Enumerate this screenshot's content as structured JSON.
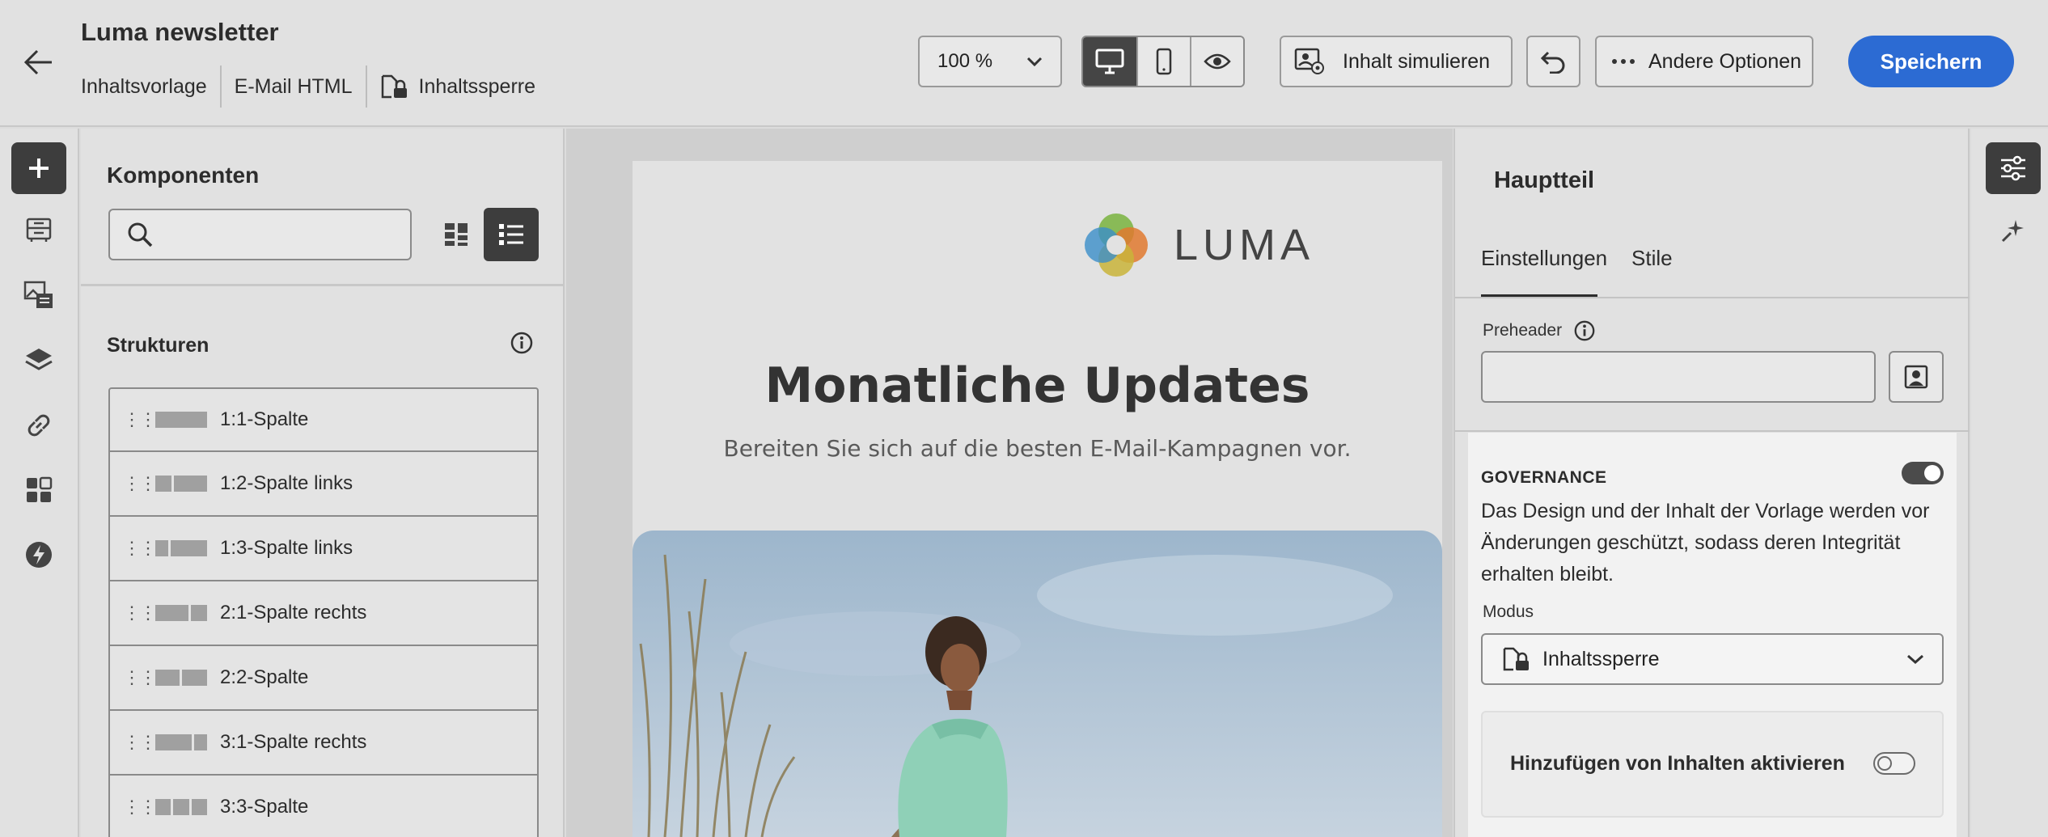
{
  "header": {
    "title": "Luma newsletter",
    "meta": [
      "Inhaltsvorlage",
      "E-Mail HTML"
    ],
    "lock_label": "Inhaltssperre",
    "zoom": "100 %",
    "simulate_label": "Inhalt simulieren",
    "options_label": "Andere Optionen",
    "save_label": "Speichern",
    "accent_color": "#2c6bd3"
  },
  "components": {
    "title": "Komponenten",
    "search_placeholder": "",
    "structures_title": "Strukturen",
    "structures": [
      {
        "label": "1:1-Spalte"
      },
      {
        "label": "1:2-Spalte links"
      },
      {
        "label": "1:3-Spalte links"
      },
      {
        "label": "2:1-Spalte rechts"
      },
      {
        "label": "2:2-Spalte"
      },
      {
        "label": "3:1-Spalte rechts"
      },
      {
        "label": "3:3-Spalte"
      }
    ]
  },
  "email": {
    "brand": "LUMA",
    "heading": "Monatliche Updates",
    "subheading": "Bereiten Sie sich auf die besten E-Mail-Kampagnen vor."
  },
  "properties": {
    "title": "Hauptteil",
    "tabs": [
      "Einstellungen",
      "Stile"
    ],
    "preheader_label": "Preheader",
    "preheader_value": "",
    "governance_label": "GOVERNANCE",
    "governance_on": true,
    "governance_desc": "Das Design und der Inhalt der Vorlage werden vor Änderungen geschützt, sodass deren Integrität erhalten bleibt.",
    "mode_label": "Modus",
    "mode_value": "Inhaltssperre",
    "add_content_label": "Hinzufügen von Inhalten aktivieren",
    "add_content_on": false
  },
  "icons": {
    "back": "arrow-left-icon",
    "rail": [
      "plus-icon",
      "fragment-icon",
      "assets-icon",
      "layers-icon",
      "link-icon",
      "components-icon",
      "lightning-icon"
    ],
    "right_rail": [
      "properties-icon",
      "ai-sparkle-icon"
    ]
  }
}
